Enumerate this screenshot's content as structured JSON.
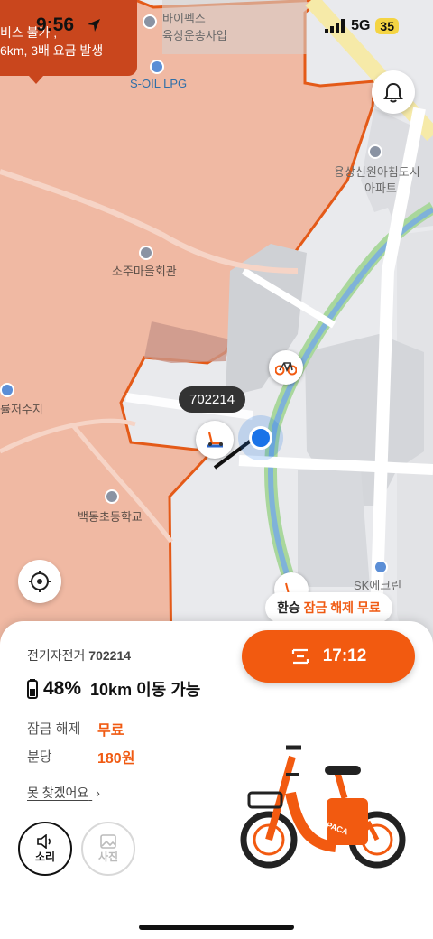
{
  "status_bar": {
    "time": "9:56",
    "network": "5G",
    "battery": "35"
  },
  "notice": {
    "line1": "비스 불가 ,",
    "line2": "6km, 3배 요금 발생"
  },
  "map": {
    "labels": {
      "biopex": "바이펙스",
      "biopex2": "육상운송사업",
      "soil": "S-OIL LPG",
      "apt": "용상신원아침도시",
      "apt2": "아파트",
      "hall": "소주마을회관",
      "reservoir": "률저수지",
      "school": "백동초등학교",
      "sk": "SK에크린"
    },
    "vehicle_id_bubble": "702214"
  },
  "transfer": {
    "prefix": "환승 ",
    "highlight": "잠금 해제 무료"
  },
  "ride_button": {
    "label": "17:12"
  },
  "sheet": {
    "vehicle_type": "전기자전거",
    "vehicle_id": "702214",
    "battery_pct": "48%",
    "range": "10km 이동 가능",
    "unlock_label": "잠금 해제",
    "unlock_value": "무료",
    "per_min_label": "분당",
    "per_min_value": "180원",
    "cant_find": "못 찾겠어요",
    "sound_label": "소리",
    "photo_label": "사진",
    "bike_brand": "ALPACA"
  },
  "colors": {
    "accent": "#f25a10",
    "zone_fill": "#f0b9a3",
    "zone_border": "#e45a18",
    "road": "#ffffff",
    "river": "#7fb2d9"
  }
}
